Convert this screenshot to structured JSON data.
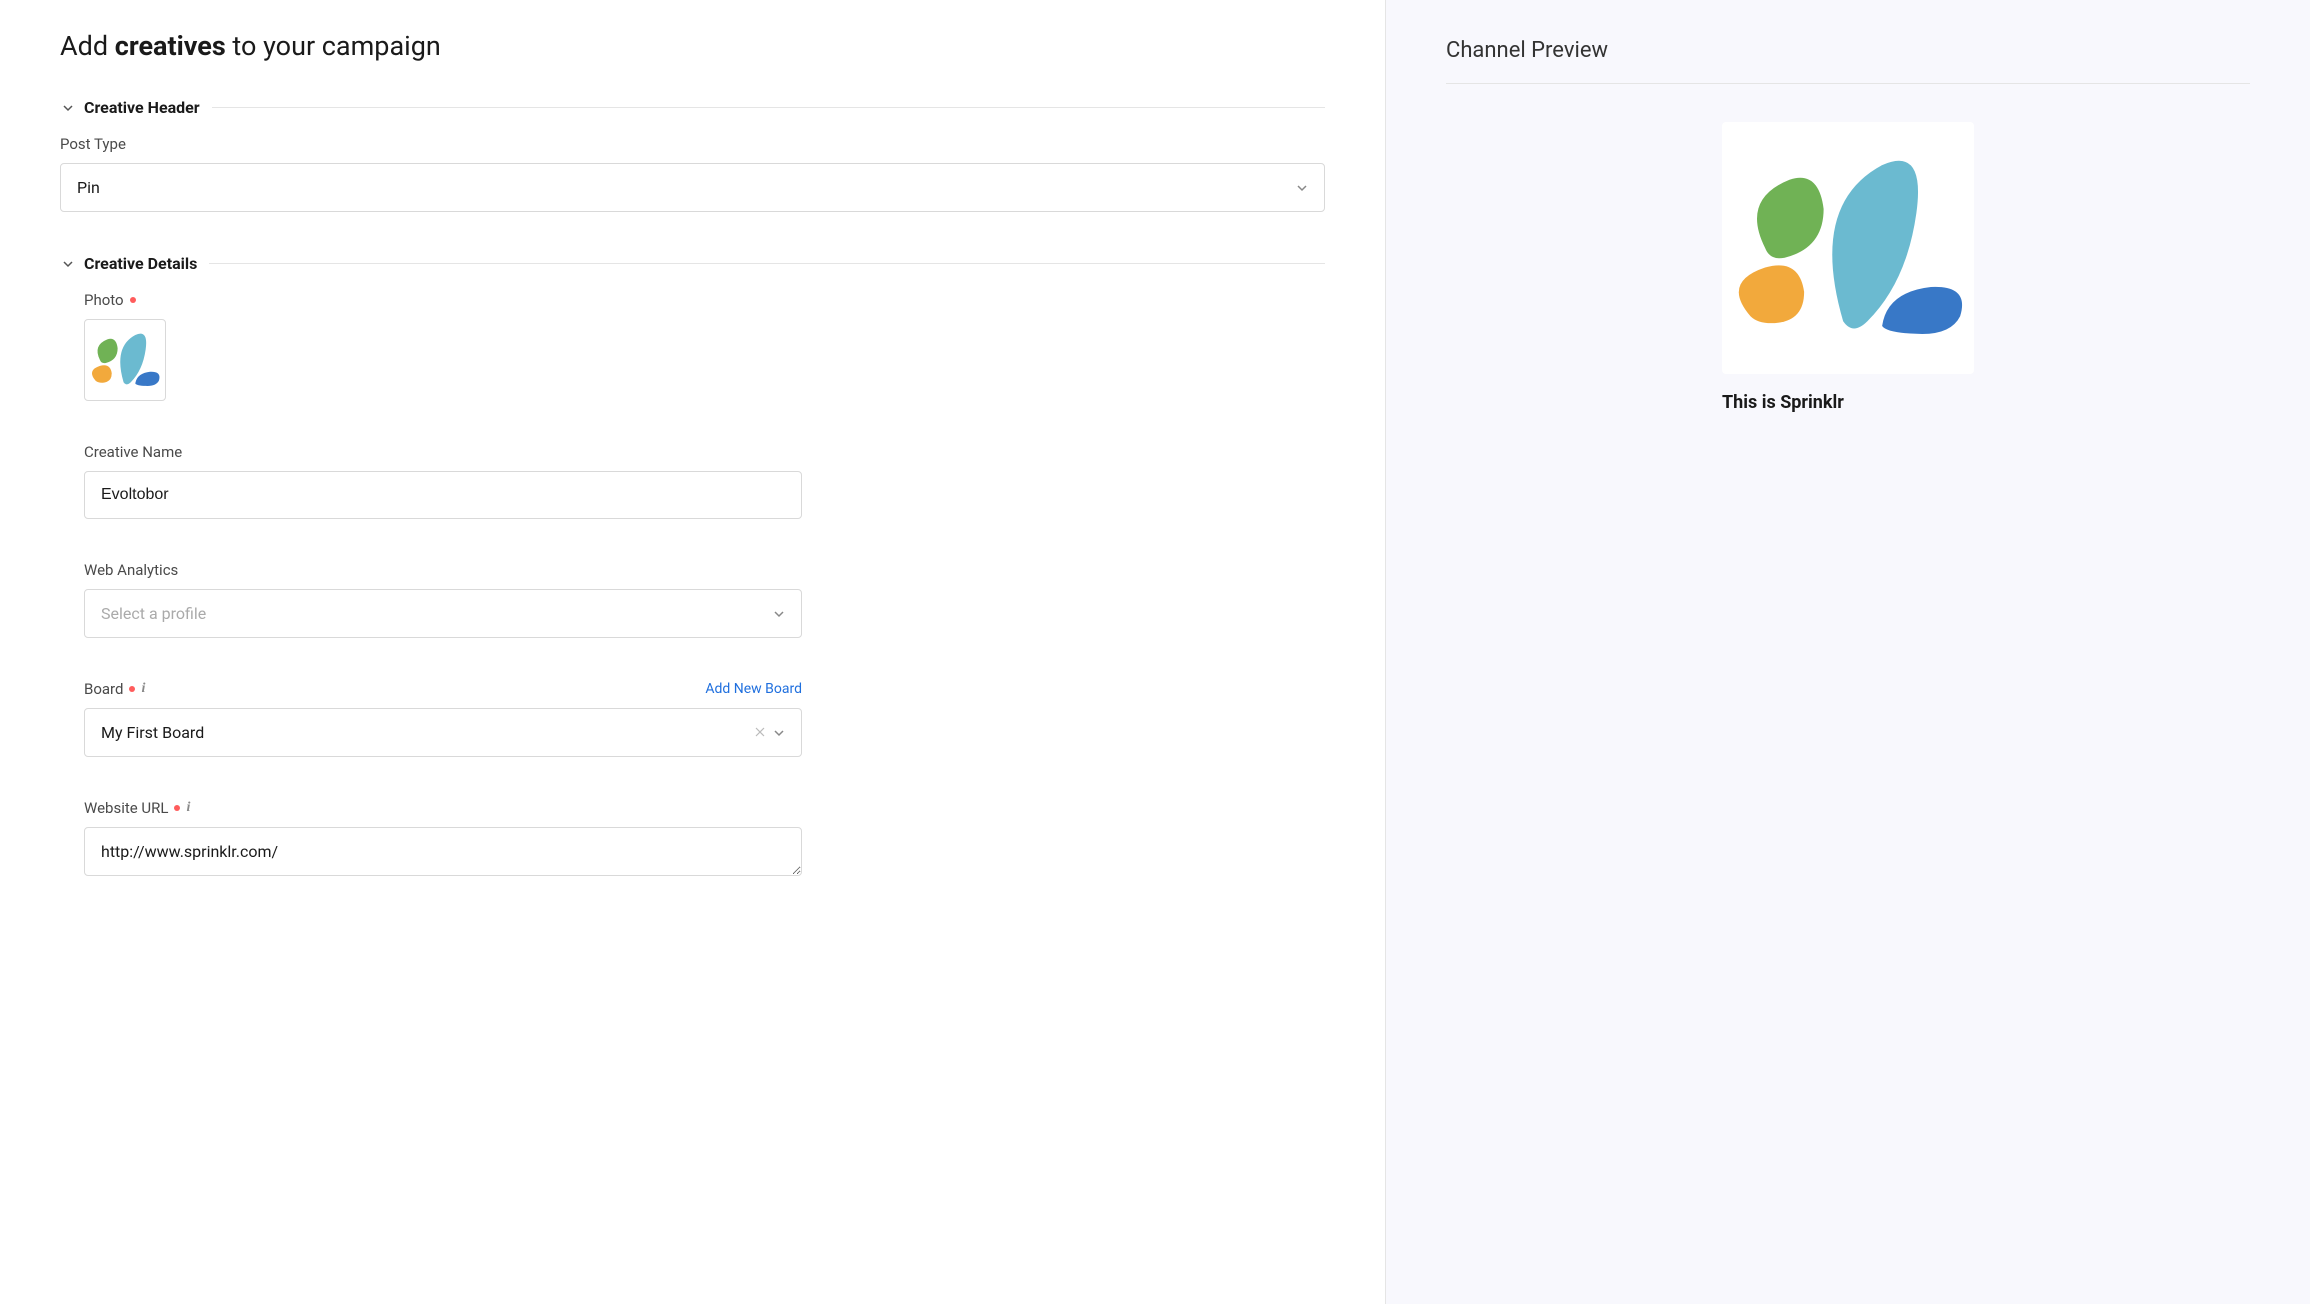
{
  "pageTitle": {
    "before": "Add ",
    "bold": "creatives",
    "after": " to your campaign"
  },
  "sections": {
    "header": {
      "title": "Creative Header",
      "postType": {
        "label": "Post Type",
        "value": "Pin"
      }
    },
    "details": {
      "title": "Creative Details",
      "photo": {
        "label": "Photo"
      },
      "creativeName": {
        "label": "Creative Name",
        "value": "Evoltobor"
      },
      "webAnalytics": {
        "label": "Web Analytics",
        "placeholder": "Select a profile"
      },
      "board": {
        "label": "Board",
        "value": "My First Board",
        "addNew": "Add New Board"
      },
      "websiteUrl": {
        "label": "Website URL",
        "value": "http://www.sprinklr.com/"
      }
    }
  },
  "preview": {
    "title": "Channel Preview",
    "cardTitle": "This is Sprinklr"
  }
}
